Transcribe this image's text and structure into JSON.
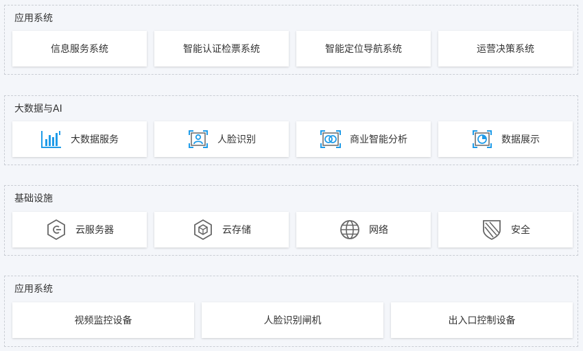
{
  "sections": [
    {
      "title": "应用系统",
      "items": [
        {
          "label": "信息服务系统"
        },
        {
          "label": "智能认证检票系统"
        },
        {
          "label": "智能定位导航系统"
        },
        {
          "label": "运营决策系统"
        }
      ]
    },
    {
      "title": "大数据与AI",
      "items": [
        {
          "label": "大数据服务",
          "icon": "bar-chart-icon"
        },
        {
          "label": "人脸识别",
          "icon": "face-recognition-icon"
        },
        {
          "label": "商业智能分析",
          "icon": "business-analysis-icon"
        },
        {
          "label": "数据展示",
          "icon": "pie-chart-icon"
        }
      ]
    },
    {
      "title": "基础设施",
      "items": [
        {
          "label": "云服务器",
          "icon": "cloud-server-icon"
        },
        {
          "label": "云存储",
          "icon": "cloud-storage-icon"
        },
        {
          "label": "网络",
          "icon": "network-globe-icon"
        },
        {
          "label": "安全",
          "icon": "security-shield-icon"
        }
      ]
    },
    {
      "title": "应用系统",
      "items": [
        {
          "label": "视频监控设备"
        },
        {
          "label": "人脸识别闸机"
        },
        {
          "label": "出入口控制设备"
        }
      ]
    }
  ],
  "colors": {
    "accent_blue": "#1e9be8",
    "icon_gray": "#666666",
    "border_dashed": "#c9cdd4",
    "background": "#f4f6fa"
  }
}
